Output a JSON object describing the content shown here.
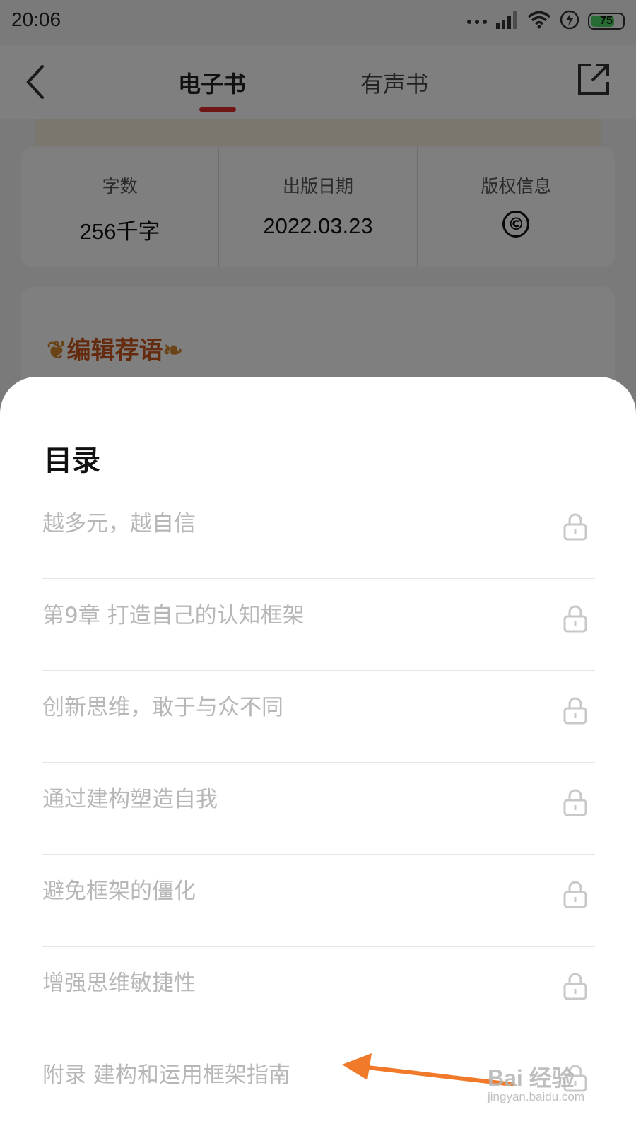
{
  "status_bar": {
    "time": "20:06",
    "battery": "75",
    "icons": [
      "more-dots-icon",
      "signal-icon",
      "wifi-icon",
      "charging-icon",
      "battery-icon"
    ]
  },
  "nav": {
    "tabs": [
      {
        "label": "电子书",
        "active": true
      },
      {
        "label": "有声书",
        "active": false
      }
    ],
    "accent_color": "#e02c2c"
  },
  "book_info": {
    "cells": [
      {
        "label": "字数",
        "value": "256千字"
      },
      {
        "label": "出版日期",
        "value": "2022.03.23"
      },
      {
        "label": "版权信息",
        "value": "©"
      }
    ]
  },
  "editor_section": {
    "title": "编辑荐语"
  },
  "toc": {
    "title": "目录",
    "items": [
      {
        "label": "越多元，越自信",
        "locked": true
      },
      {
        "label": "第9章 打造自己的认知框架",
        "locked": true
      },
      {
        "label": "创新思维，敢于与众不同",
        "locked": true
      },
      {
        "label": "通过建构塑造自我",
        "locked": true
      },
      {
        "label": "避免框架的僵化",
        "locked": true
      },
      {
        "label": "增强思维敏捷性",
        "locked": true
      },
      {
        "label": "附录 建构和运用框架指南",
        "locked": true
      }
    ]
  },
  "watermark": {
    "text": "Bai 经验",
    "sub": "jingyan.baidu.com"
  },
  "annotation_color": "#f07a2a"
}
